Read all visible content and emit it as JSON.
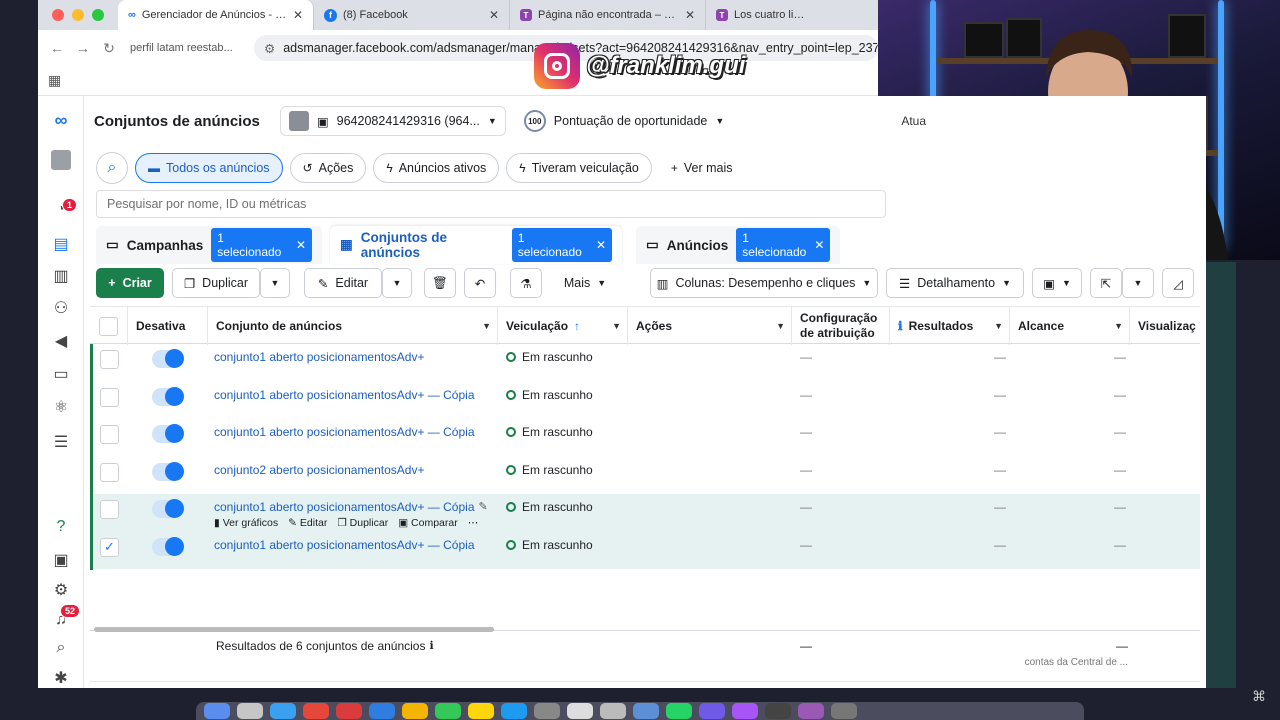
{
  "browser": {
    "tabs": [
      {
        "title": "Gerenciador de Anúncios - Gerenciador",
        "favicon": "meta-icon",
        "active": true
      },
      {
        "title": "(8) Facebook",
        "favicon": "facebook-icon",
        "active": false
      },
      {
        "title": "Página não encontrada – Los",
        "favicon": "t-icon",
        "active": false
      },
      {
        "title": "Los cuatro libros del EVANGE",
        "favicon": "t-icon",
        "active": false
      }
    ],
    "breadcrumb": "perfil latam reestab...",
    "url": "adsmanager.facebook.com/adsmanager/manage/adsets?act=964208241429316&nav_entry_point=lep_237&s"
  },
  "overlay": {
    "handle": "@franklim.gui"
  },
  "header": {
    "title": "Conjuntos de anúncios",
    "account": "964208241429316 (964...",
    "opportunity_score": "100",
    "opportunity_label": "Pontuação de oportunidade",
    "updated": "Atua"
  },
  "rail": {
    "notif_badge": "1",
    "alerts_badge": "52"
  },
  "filters": {
    "items": [
      "Todos os anúncios",
      "Ações",
      "Anúncios ativos",
      "Tiveram veiculação",
      "Ver mais"
    ],
    "search_placeholder": "Pesquisar por nome, ID ou métricas"
  },
  "level_tabs": [
    {
      "label": "Campanhas",
      "selected": "1 selecionado"
    },
    {
      "label": "Conjuntos de anúncios",
      "selected": "1 selecionado"
    },
    {
      "label": "Anúncios",
      "selected": "1 selecionado"
    }
  ],
  "toolbar": {
    "create": "Criar",
    "duplicate": "Duplicar",
    "edit": "Editar",
    "more": "Mais",
    "columns": "Colunas: Desempenho e cliques",
    "breakdown": "Detalhamento"
  },
  "table": {
    "columns": [
      "Desativa",
      "Conjunto de anúncios",
      "Veiculação",
      "Ações",
      "Configuração de atribuição",
      "Resultados",
      "Alcance",
      "Visualizaç"
    ],
    "rows": [
      {
        "name": "conjunto1 aberto posicionamentosAdv+",
        "status": "Em rascunho",
        "checked": false
      },
      {
        "name": "conjunto1 aberto posicionamentosAdv+ — Cópia",
        "status": "Em rascunho",
        "checked": false
      },
      {
        "name": "conjunto1 aberto posicionamentosAdv+ — Cópia",
        "status": "Em rascunho",
        "checked": false
      },
      {
        "name": "conjunto2 aberto posicionamentosAdv+",
        "status": "Em rascunho",
        "checked": false
      },
      {
        "name": "conjunto1 aberto posicionamentosAdv+ — Cópia",
        "status": "Em rascunho",
        "checked": false
      },
      {
        "name": "conjunto1 aberto posicionamentosAdv+ — Cópia",
        "status": "Em rascunho",
        "checked": true
      }
    ],
    "row_actions": [
      "Ver gráficos",
      "Editar",
      "Duplicar",
      "Comparar"
    ],
    "empty": "—",
    "footer_label": "Resultados de 6 conjuntos de anúncios",
    "footer_reach_note": "contas da Central de ..."
  },
  "colors": {
    "accent": "#1877f2",
    "create": "#1a7f4b",
    "highlight": "#e6f2f1"
  }
}
